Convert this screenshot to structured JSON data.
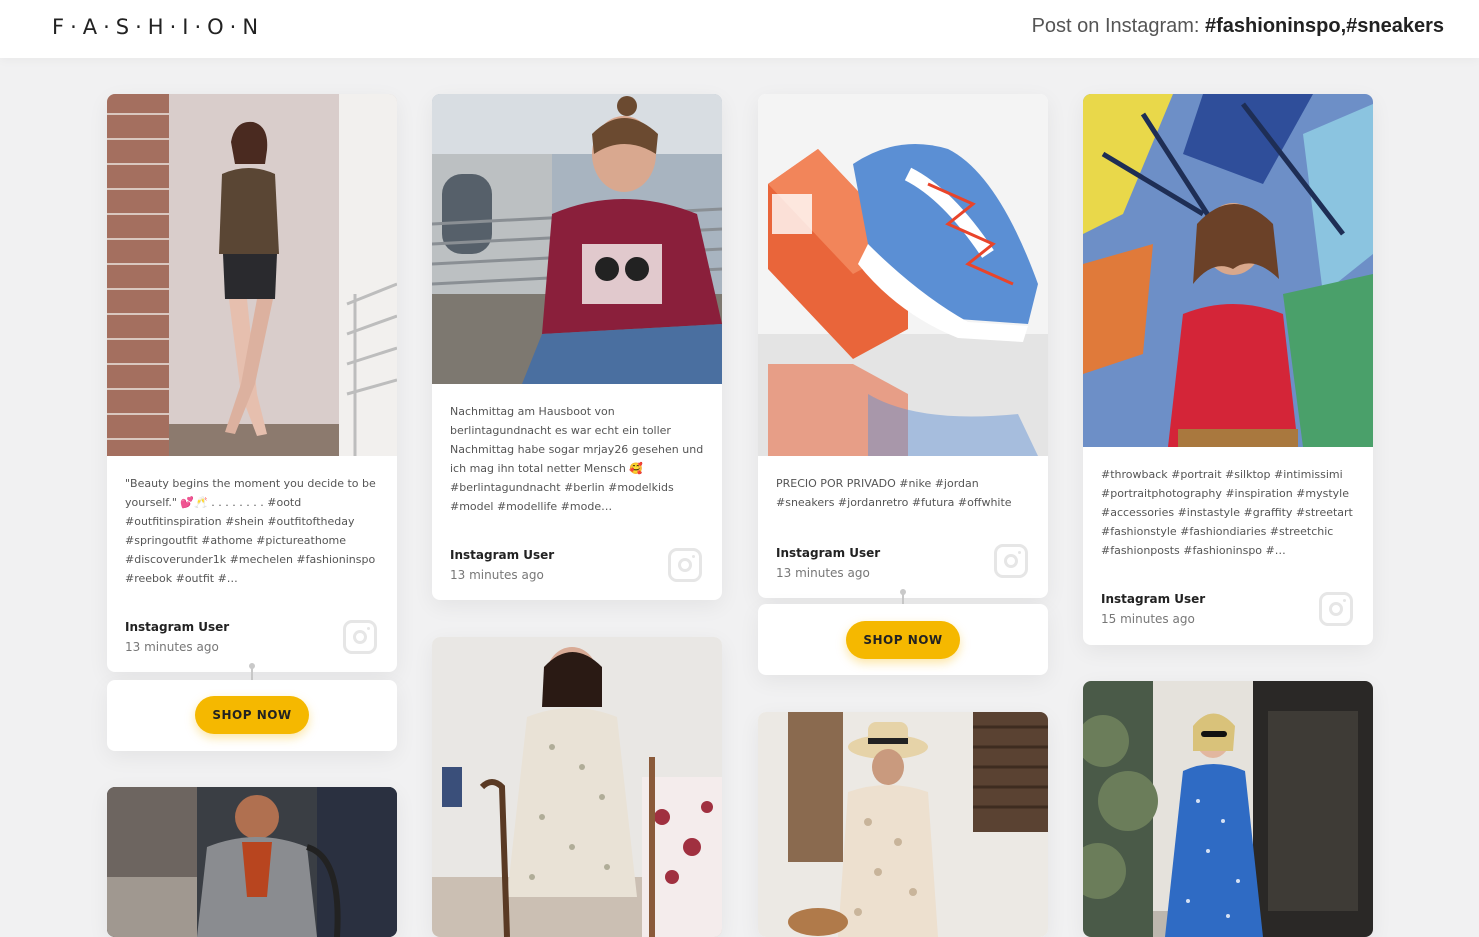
{
  "header": {
    "logo": "F·A·S·H·I·O·N",
    "prefix": "Post on Instagram:",
    "tags": "#fashioninspo,#sneakers"
  },
  "posts": [
    {
      "caption": "\"Beauty begins the moment you decide to be yourself.\" 💕🥂 . . . . . . . . #ootd #outfitinspiration #shein #outfitoftheday #springoutfit #athome #pictureathome #discoverunder1k #mechelen #fashioninspo #reebok #outfit #…",
      "user": "Instagram User",
      "time": "13 minutes ago"
    },
    {
      "caption": "Nachmittag am Hausboot von berlintagundnacht es war echt ein toller Nachmittag habe sogar mrjay26 gesehen und ich mag ihn total netter Mensch 🥰 #berlintagundnacht #berlin #modelkids #model #modellife #mode…",
      "user": "Instagram User",
      "time": "13 minutes ago"
    },
    {
      "caption": "PRECIO POR PRIVADO #nike #jordan #sneakers #jordanretro #futura #offwhite",
      "user": "Instagram User",
      "time": "13 minutes ago"
    },
    {
      "caption": "#throwback #portrait #silktop #intimissimi #portraitphotography #inspiration #mystyle #accessories #instastyle #graffity #streetart #fashionstyle #fashiondiaries #streetchic #fashionposts #fashioninspo #…",
      "user": "Instagram User",
      "time": "15 minutes ago"
    }
  ],
  "shop_label": "SHOP NOW",
  "colors": {
    "accent": "#f5b800",
    "background": "#f1f1f2"
  }
}
